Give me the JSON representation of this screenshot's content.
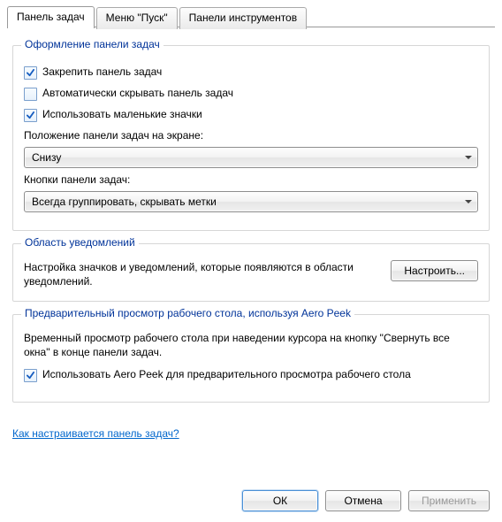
{
  "tabs": {
    "taskbar": "Панель задач",
    "start_menu": "Меню \"Пуск\"",
    "toolbars": "Панели инструментов"
  },
  "group_appearance": {
    "title": "Оформление панели задач",
    "lock_taskbar": "Закрепить панель задач",
    "auto_hide": "Автоматически скрывать панель задач",
    "small_icons": "Использовать маленькие значки",
    "position_label": "Положение панели задач на экране:",
    "position_value": "Снизу",
    "buttons_label": "Кнопки панели задач:",
    "buttons_value": "Всегда группировать, скрывать метки"
  },
  "group_notify": {
    "title": "Область уведомлений",
    "text": "Настройка значков и уведомлений, которые появляются в области уведомлений.",
    "customize": "Настроить..."
  },
  "group_aero": {
    "title": "Предварительный просмотр рабочего стола, используя Aero Peek",
    "text": "Временный просмотр рабочего стола при наведении курсора на кнопку \"Свернуть все окна\" в конце панели задач.",
    "use_aero_peek": "Использовать Aero Peek для предварительного просмотра рабочего стола"
  },
  "help_link": "Как настраивается панель задач?",
  "buttons": {
    "ok": "ОК",
    "cancel": "Отмена",
    "apply": "Применить"
  }
}
